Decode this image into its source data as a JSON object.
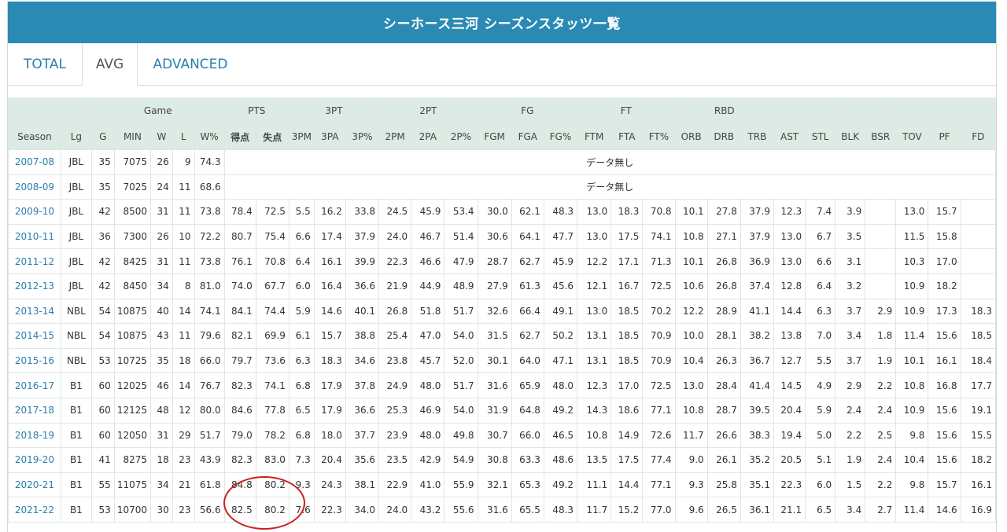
{
  "header": {
    "title": "シーホース三河 シーズンスタッツ一覧"
  },
  "tabs": [
    {
      "label": "TOTAL",
      "active": false
    },
    {
      "label": "AVG",
      "active": true
    },
    {
      "label": "ADVANCED",
      "active": false
    }
  ],
  "table": {
    "groups": [
      {
        "label": "",
        "span": 1
      },
      {
        "label": "",
        "span": 1
      },
      {
        "label": "Game",
        "span": 5
      },
      {
        "label": "PTS",
        "span": 2
      },
      {
        "label": "3PT",
        "span": 3
      },
      {
        "label": "2PT",
        "span": 3
      },
      {
        "label": "FG",
        "span": 3
      },
      {
        "label": "FT",
        "span": 3
      },
      {
        "label": "RBD",
        "span": 3
      },
      {
        "label": "",
        "span": 1
      },
      {
        "label": "",
        "span": 1
      },
      {
        "label": "",
        "span": 1
      },
      {
        "label": "",
        "span": 1
      },
      {
        "label": "",
        "span": 1
      },
      {
        "label": "",
        "span": 1
      },
      {
        "label": "",
        "span": 1
      }
    ],
    "columns": [
      "Season",
      "Lg",
      "G",
      "MIN",
      "W",
      "L",
      "W%",
      "得点",
      "失点",
      "3PM",
      "3PA",
      "3P%",
      "2PM",
      "2PA",
      "2P%",
      "FGM",
      "FGA",
      "FG%",
      "FTM",
      "FTA",
      "FT%",
      "ORB",
      "DRB",
      "TRB",
      "AST",
      "STL",
      "BLK",
      "BSR",
      "TOV",
      "PF",
      "FD"
    ],
    "no_data_label": "データ無し",
    "rows": [
      {
        "season": "2007-08",
        "lg": "JBL",
        "game": [
          "35",
          "7075",
          "26",
          "9",
          "74.3"
        ],
        "nodata": true
      },
      {
        "season": "2008-09",
        "lg": "JBL",
        "game": [
          "35",
          "7025",
          "24",
          "11",
          "68.6"
        ],
        "nodata": true
      },
      {
        "season": "2009-10",
        "lg": "JBL",
        "game": [
          "42",
          "8500",
          "31",
          "11",
          "73.8"
        ],
        "stats": [
          "78.4",
          "72.5",
          "5.5",
          "16.2",
          "33.8",
          "24.5",
          "45.9",
          "53.4",
          "30.0",
          "62.1",
          "48.3",
          "13.0",
          "18.3",
          "70.8",
          "10.1",
          "27.8",
          "37.9",
          "12.3",
          "7.4",
          "3.9",
          "",
          "13.0",
          "15.7",
          ""
        ]
      },
      {
        "season": "2010-11",
        "lg": "JBL",
        "game": [
          "36",
          "7300",
          "26",
          "10",
          "72.2"
        ],
        "stats": [
          "80.7",
          "75.4",
          "6.6",
          "17.4",
          "37.9",
          "24.0",
          "46.7",
          "51.4",
          "30.6",
          "64.1",
          "47.7",
          "13.0",
          "17.5",
          "74.1",
          "10.8",
          "27.1",
          "37.9",
          "13.0",
          "6.7",
          "3.5",
          "",
          "11.5",
          "15.8",
          ""
        ]
      },
      {
        "season": "2011-12",
        "lg": "JBL",
        "game": [
          "42",
          "8425",
          "31",
          "11",
          "73.8"
        ],
        "stats": [
          "76.1",
          "70.8",
          "6.4",
          "16.1",
          "39.9",
          "22.3",
          "46.6",
          "47.9",
          "28.7",
          "62.7",
          "45.9",
          "12.2",
          "17.1",
          "71.3",
          "10.1",
          "26.8",
          "36.9",
          "13.0",
          "6.6",
          "3.1",
          "",
          "10.3",
          "17.0",
          ""
        ]
      },
      {
        "season": "2012-13",
        "lg": "JBL",
        "game": [
          "42",
          "8450",
          "34",
          "8",
          "81.0"
        ],
        "stats": [
          "74.0",
          "67.7",
          "6.0",
          "16.4",
          "36.6",
          "21.9",
          "44.9",
          "48.9",
          "27.9",
          "61.3",
          "45.6",
          "12.1",
          "16.7",
          "72.5",
          "10.6",
          "26.8",
          "37.4",
          "12.8",
          "6.4",
          "3.2",
          "",
          "10.9",
          "18.2",
          ""
        ]
      },
      {
        "season": "2013-14",
        "lg": "NBL",
        "game": [
          "54",
          "10875",
          "40",
          "14",
          "74.1"
        ],
        "stats": [
          "84.1",
          "74.4",
          "5.9",
          "14.6",
          "40.1",
          "26.8",
          "51.8",
          "51.7",
          "32.6",
          "66.4",
          "49.1",
          "13.0",
          "18.5",
          "70.2",
          "12.2",
          "28.9",
          "41.1",
          "14.4",
          "6.3",
          "3.7",
          "2.9",
          "10.9",
          "17.3",
          "18.3"
        ]
      },
      {
        "season": "2014-15",
        "lg": "NBL",
        "game": [
          "54",
          "10875",
          "43",
          "11",
          "79.6"
        ],
        "stats": [
          "82.1",
          "69.9",
          "6.1",
          "15.7",
          "38.8",
          "25.4",
          "47.0",
          "54.0",
          "31.5",
          "62.7",
          "50.2",
          "13.1",
          "18.5",
          "70.9",
          "10.0",
          "28.1",
          "38.2",
          "13.8",
          "7.0",
          "3.4",
          "1.8",
          "11.4",
          "15.6",
          "18.5"
        ]
      },
      {
        "season": "2015-16",
        "lg": "NBL",
        "game": [
          "53",
          "10725",
          "35",
          "18",
          "66.0"
        ],
        "stats": [
          "79.7",
          "73.6",
          "6.3",
          "18.3",
          "34.6",
          "23.8",
          "45.7",
          "52.0",
          "30.1",
          "64.0",
          "47.1",
          "13.1",
          "18.5",
          "70.9",
          "10.4",
          "26.3",
          "36.7",
          "12.7",
          "5.5",
          "3.7",
          "1.9",
          "10.1",
          "16.1",
          "18.4"
        ]
      },
      {
        "season": "2016-17",
        "lg": "B1",
        "game": [
          "60",
          "12025",
          "46",
          "14",
          "76.7"
        ],
        "stats": [
          "82.3",
          "74.1",
          "6.8",
          "17.9",
          "37.8",
          "24.9",
          "48.0",
          "51.7",
          "31.6",
          "65.9",
          "48.0",
          "12.3",
          "17.0",
          "72.5",
          "13.0",
          "28.4",
          "41.4",
          "14.5",
          "4.9",
          "2.9",
          "2.2",
          "10.8",
          "16.8",
          "17.7"
        ]
      },
      {
        "season": "2017-18",
        "lg": "B1",
        "game": [
          "60",
          "12125",
          "48",
          "12",
          "80.0"
        ],
        "stats": [
          "84.6",
          "77.8",
          "6.5",
          "17.9",
          "36.6",
          "25.3",
          "46.9",
          "54.0",
          "31.9",
          "64.8",
          "49.2",
          "14.3",
          "18.6",
          "77.1",
          "10.8",
          "28.7",
          "39.5",
          "20.4",
          "5.9",
          "2.4",
          "2.4",
          "10.9",
          "15.6",
          "19.1"
        ]
      },
      {
        "season": "2018-19",
        "lg": "B1",
        "game": [
          "60",
          "12050",
          "31",
          "29",
          "51.7"
        ],
        "stats": [
          "79.0",
          "78.2",
          "6.8",
          "18.0",
          "37.7",
          "23.9",
          "48.0",
          "49.8",
          "30.7",
          "66.0",
          "46.5",
          "10.8",
          "14.9",
          "72.6",
          "11.7",
          "26.6",
          "38.3",
          "19.4",
          "5.0",
          "2.2",
          "2.5",
          "9.8",
          "15.6",
          "15.5"
        ]
      },
      {
        "season": "2019-20",
        "lg": "B1",
        "game": [
          "41",
          "8275",
          "18",
          "23",
          "43.9"
        ],
        "stats": [
          "82.3",
          "83.0",
          "7.3",
          "20.4",
          "35.6",
          "23.5",
          "42.9",
          "54.9",
          "30.8",
          "63.3",
          "48.6",
          "13.5",
          "17.5",
          "77.4",
          "9.0",
          "26.1",
          "35.2",
          "20.5",
          "5.1",
          "1.9",
          "2.4",
          "10.4",
          "15.6",
          "18.2"
        ]
      },
      {
        "season": "2020-21",
        "lg": "B1",
        "game": [
          "55",
          "11075",
          "34",
          "21",
          "61.8"
        ],
        "stats": [
          "84.8",
          "80.2",
          "9.3",
          "24.3",
          "38.1",
          "22.9",
          "41.0",
          "55.9",
          "32.1",
          "65.3",
          "49.2",
          "11.1",
          "14.4",
          "77.1",
          "9.3",
          "25.8",
          "35.1",
          "22.3",
          "6.0",
          "1.5",
          "2.2",
          "9.8",
          "15.7",
          "16.1"
        ]
      },
      {
        "season": "2021-22",
        "lg": "B1",
        "game": [
          "53",
          "10700",
          "30",
          "23",
          "56.6"
        ],
        "stats": [
          "82.5",
          "80.2",
          "7.6",
          "22.3",
          "34.0",
          "24.0",
          "43.2",
          "55.6",
          "31.6",
          "65.5",
          "48.3",
          "11.7",
          "15.2",
          "77.0",
          "9.6",
          "26.5",
          "36.1",
          "21.1",
          "6.5",
          "3.4",
          "2.7",
          "11.4",
          "14.6",
          "16.9"
        ]
      }
    ]
  },
  "colors": {
    "header_bg": "#2a8ab3",
    "table_head_bg": "#dcebe3",
    "link": "#2a7eac",
    "annotation": "#cc2020"
  }
}
